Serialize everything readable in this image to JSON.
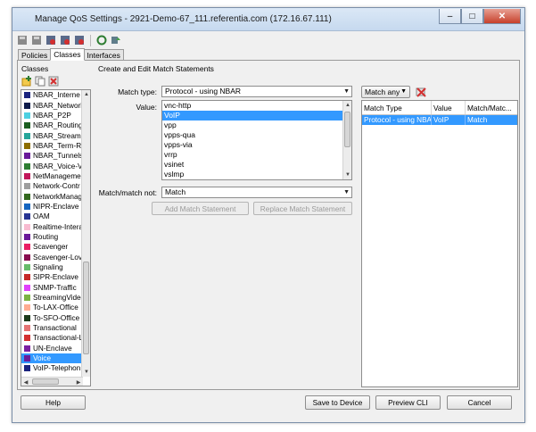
{
  "window": {
    "title": "Manage QoS Settings - 2921-Demo-67_111.referentia.com (172.16.67.111)"
  },
  "toolbar": {
    "icons": [
      "disk-gray-icon",
      "disk-gray-icon",
      "shield-red-icon",
      "shield-red-icon",
      "shield-red-icon",
      "refresh-green-icon",
      "deploy-green-icon"
    ]
  },
  "tabs": [
    {
      "label": "Policies",
      "active": false
    },
    {
      "label": "Classes",
      "active": true
    },
    {
      "label": "Interfaces",
      "active": false
    }
  ],
  "classes_panel": {
    "label": "Classes",
    "items": [
      {
        "label": "NBAR_Interne",
        "color": "#1a237e"
      },
      {
        "label": "NBAR_Network",
        "color": "#0d1b4a"
      },
      {
        "label": "NBAR_P2P",
        "color": "#4dd0e1"
      },
      {
        "label": "NBAR_Routing",
        "color": "#1b5e20"
      },
      {
        "label": "NBAR_Streami",
        "color": "#26a69a"
      },
      {
        "label": "NBAR_Term-Re",
        "color": "#8d6e00"
      },
      {
        "label": "NBAR_Tunnels",
        "color": "#6a1b9a"
      },
      {
        "label": "NBAR_Voice-Vi",
        "color": "#2e7d32"
      },
      {
        "label": "NetManagemer",
        "color": "#c2185b"
      },
      {
        "label": "Network-Contr",
        "color": "#9e9e9e"
      },
      {
        "label": "NetworkManag",
        "color": "#33691e"
      },
      {
        "label": "NIPR-Enclave",
        "color": "#1565c0"
      },
      {
        "label": "OAM",
        "color": "#283593"
      },
      {
        "label": "Realtime-Intera",
        "color": "#f8bbd0"
      },
      {
        "label": "Routing",
        "color": "#6a1b9a"
      },
      {
        "label": "Scavenger",
        "color": "#e91e63"
      },
      {
        "label": "Scavenger-Lov",
        "color": "#880e4f"
      },
      {
        "label": "Signaling",
        "color": "#66bb6a"
      },
      {
        "label": "SIPR-Enclave",
        "color": "#c62828"
      },
      {
        "label": "SNMP-Traffic",
        "color": "#e040fb"
      },
      {
        "label": "StreamingVideo",
        "color": "#7cb342"
      },
      {
        "label": "To-LAX-Office",
        "color": "#ffab91"
      },
      {
        "label": "To-SFO-Office",
        "color": "#1b3a1b"
      },
      {
        "label": "Transactional",
        "color": "#e57373"
      },
      {
        "label": "Transactional-L",
        "color": "#d32f2f"
      },
      {
        "label": "UN-Enclave",
        "color": "#7b1fa2"
      },
      {
        "label": "Voice",
        "color": "#6a1b9a",
        "selected": true
      },
      {
        "label": "VoIP-Telephon",
        "color": "#1a237e"
      }
    ]
  },
  "editor": {
    "heading": "Create and Edit Match Statements",
    "match_type_label": "Match type:",
    "match_type_value": "Protocol - using NBAR",
    "value_label": "Value:",
    "values": [
      "vnc-http",
      "VoIP",
      "vpp",
      "vpps-qua",
      "vpps-via",
      "vrrp",
      "vsinet",
      "vslmp"
    ],
    "selected_value": "VoIP",
    "match_not_label": "Match/match not:",
    "match_not_value": "Match",
    "add_button": "Add Match Statement",
    "replace_button": "Replace Match Statement"
  },
  "rules": {
    "match_mode": "Match any",
    "columns": [
      "Match Type",
      "Value",
      "Match/Matc..."
    ],
    "rows": [
      [
        "Protocol - using NBAR",
        "VoIP",
        "Match"
      ]
    ]
  },
  "footer": {
    "help": "Help",
    "save": "Save to Device",
    "preview": "Preview CLI",
    "cancel": "Cancel"
  }
}
